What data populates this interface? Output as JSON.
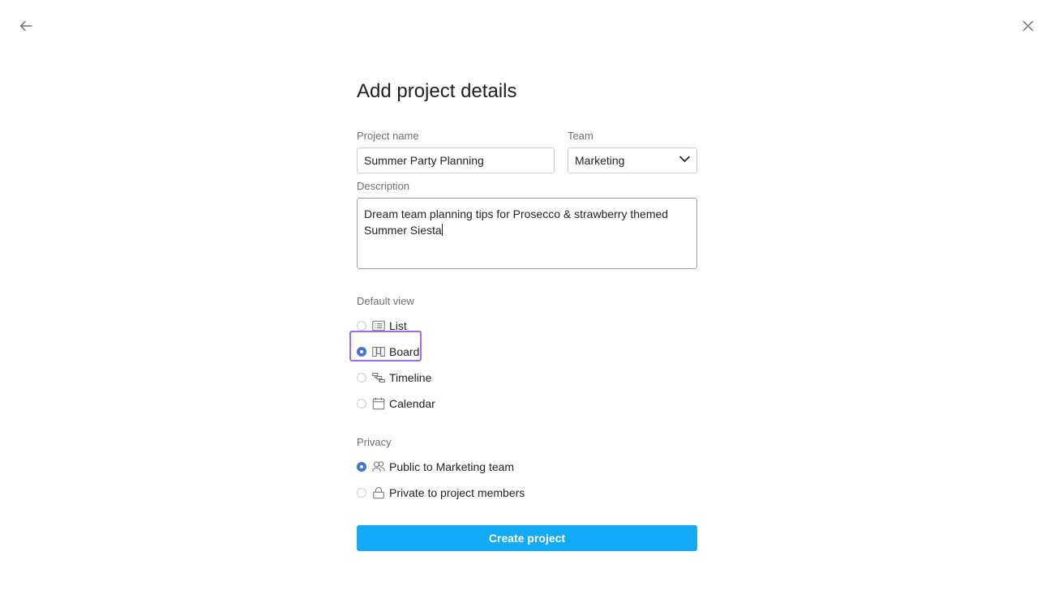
{
  "title": "Add project details",
  "project_name": {
    "label": "Project name",
    "value": "Summer Party Planning"
  },
  "team": {
    "label": "Team",
    "value": "Marketing"
  },
  "description": {
    "label": "Description",
    "value": "Dream team planning tips for Prosecco & strawberry themed Summer Siesta"
  },
  "default_view": {
    "label": "Default view",
    "options": [
      {
        "label": "List",
        "icon": "list-icon",
        "selected": false
      },
      {
        "label": "Board",
        "icon": "board-icon",
        "selected": true
      },
      {
        "label": "Timeline",
        "icon": "timeline-icon",
        "selected": false
      },
      {
        "label": "Calendar",
        "icon": "calendar-icon",
        "selected": false
      }
    ]
  },
  "privacy": {
    "label": "Privacy",
    "options": [
      {
        "label": "Public to Marketing team",
        "icon": "people-icon",
        "selected": true
      },
      {
        "label": "Private to project members",
        "icon": "lock-icon",
        "selected": false
      }
    ]
  },
  "create_button": "Create project",
  "colors": {
    "accent": "#14aaf5",
    "radio_selected": "#4573d2",
    "focus_outline": "#9b6bf2"
  }
}
